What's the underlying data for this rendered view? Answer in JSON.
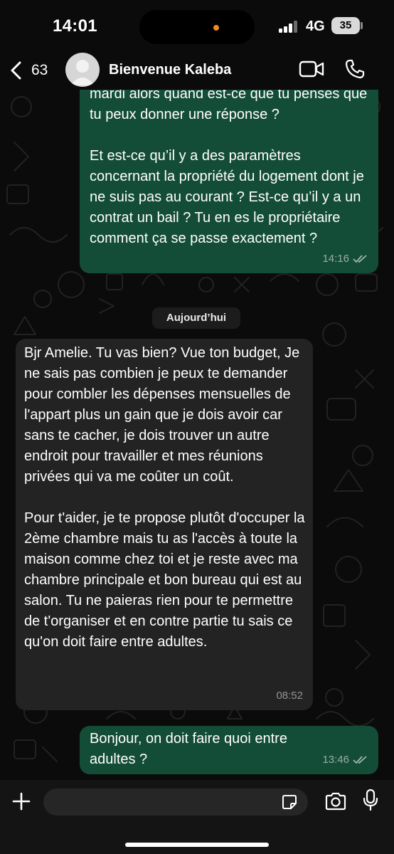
{
  "status_bar": {
    "time": "14:01",
    "network": "4G",
    "battery": "35",
    "island_dot_color": "#f08b1d"
  },
  "header": {
    "back_count": "63",
    "contact_name": "Bienvenue Kaleba",
    "icons": [
      "chevron-left-icon",
      "avatar",
      "video-call-icon",
      "phone-icon"
    ]
  },
  "messages": [
    {
      "direction": "outgoing",
      "text": "mardi alors quand est-ce que tu penses que tu peux donner une réponse ?\n\nEt est-ce qu’il y a des paramètres concernant la propriété du logement dont je ne suis pas au courant ? Est-ce qu’il y a un contrat un bail ? Tu en es le propriétaire comment ça se passe exactement ?",
      "time": "14:16",
      "status": "read"
    },
    {
      "direction": "incoming",
      "text": "Bjr Amelie. Tu vas bien? Vue ton budget, Je ne sais pas combien je peux te demander pour combler les dépenses mensuelles de l'appart plus un gain que je dois avoir car sans te cacher, je dois trouver un autre endroit pour travailler et mes réunions privées qui va me coûter un coût.\n\nPour t'aider, je te propose plutôt d'occuper la 2ème chambre mais tu as l'accès à toute la maison comme chez toi et je reste avec ma chambre principale et bon bureau qui est au salon. Tu ne paieras rien pour te permettre de t'organiser et en contre partie tu sais ce qu'on doit faire entre adultes.",
      "time": "08:52"
    },
    {
      "direction": "outgoing",
      "text": "Bonjour, on doit faire quoi entre adultes ?",
      "time": "13:46",
      "status": "read"
    }
  ],
  "date_separator": "Aujourd’hui",
  "composer": {
    "placeholder": "",
    "icons": [
      "plus-icon",
      "sticker-icon",
      "camera-icon",
      "microphone-icon"
    ]
  },
  "colors": {
    "outgoing_bubble": "#144d37",
    "incoming_bubble": "#232323",
    "background": "#0b0b0b"
  }
}
